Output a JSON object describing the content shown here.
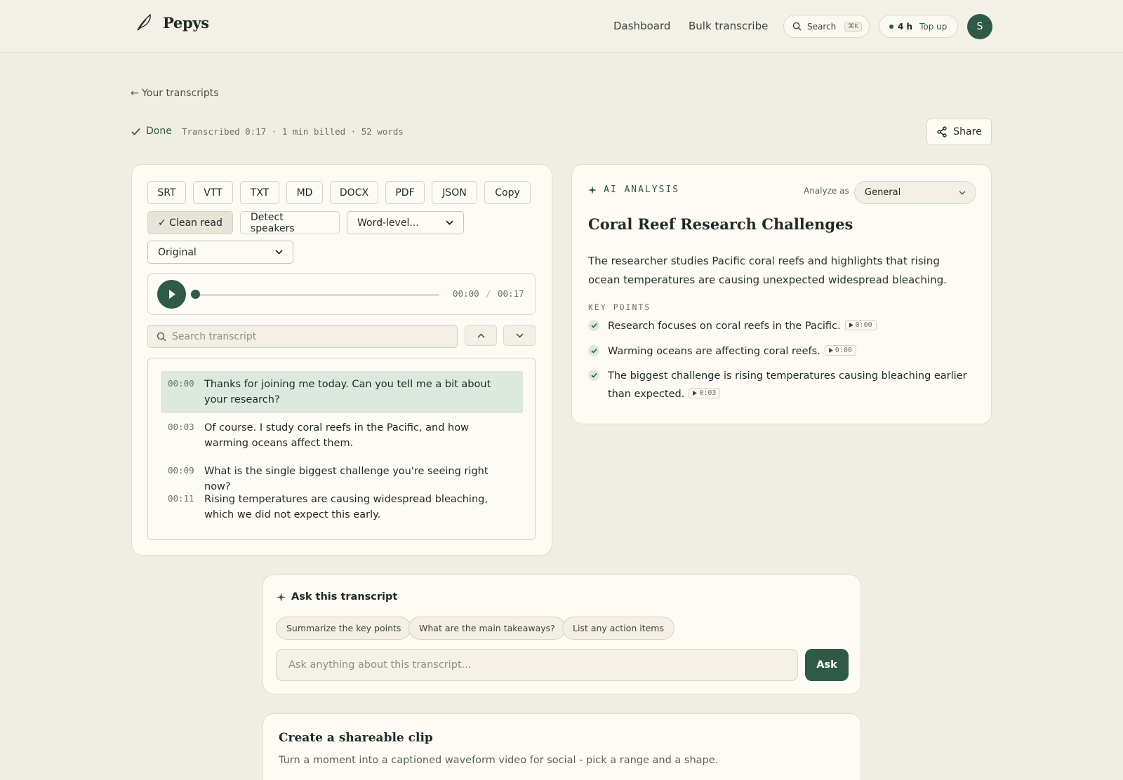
{
  "header": {
    "brand": "Pepys",
    "nav": {
      "dashboard": "Dashboard",
      "bulk": "Bulk transcribe"
    },
    "search": {
      "label": "Search",
      "shortcut": "⌘K"
    },
    "hours": {
      "amount": "4 h",
      "topup": "Top up"
    },
    "avatar_initial": "S"
  },
  "back_link": "← Your transcripts",
  "status": {
    "label": "Done",
    "meta": "Transcribed 0:17 · 1 min billed · 52 words"
  },
  "share_label": "Share",
  "export": {
    "formats": [
      "SRT",
      "VTT",
      "TXT",
      "MD",
      "DOCX",
      "PDF",
      "JSON",
      "Copy"
    ],
    "clean_read": "✓ Clean read",
    "detect_speakers": "Detect speakers",
    "word_level": "Word-level...",
    "language": "Original"
  },
  "player": {
    "current": "00:00",
    "separator": "/",
    "duration": "00:17",
    "progress": 0
  },
  "transcript_search": {
    "placeholder": "Search transcript"
  },
  "segments": [
    {
      "time": "00:00",
      "text": "Thanks for joining me today. Can you tell me a bit about your research?"
    },
    {
      "time": "00:03",
      "text": "Of course. I study coral reefs in the Pacific, and how warming oceans affect them."
    },
    {
      "time": "00:09",
      "text": "What is the single biggest challenge you're seeing right now?"
    },
    {
      "time": "00:11",
      "text": "Rising temperatures are causing widespread bleaching, which we did not expect this early."
    }
  ],
  "analysis": {
    "heading": "AI ANALYSIS",
    "analyze_as_label": "Analyze as",
    "analyze_as_value": "General",
    "title": "Coral Reef Research Challenges",
    "summary": "The researcher studies Pacific coral reefs and highlights that rising ocean temperatures are causing unexpected widespread bleaching.",
    "key_points_heading": "KEY POINTS",
    "key_points": [
      {
        "text": "Research focuses on coral reefs in the Pacific.",
        "time": "0:00"
      },
      {
        "text": "Warming oceans are affecting coral reefs.",
        "time": "0:00"
      },
      {
        "text": "The biggest challenge is rising temperatures causing bleaching earlier than expected.",
        "time": "0:03"
      }
    ]
  },
  "ask": {
    "heading": "Ask this transcript",
    "chips": [
      "Summarize the key points",
      "What are the main takeaways?",
      "List any action items"
    ],
    "placeholder": "Ask anything about this transcript...",
    "button": "Ask"
  },
  "clip": {
    "heading": "Create a shareable clip",
    "subtitle": "Turn a moment into a captioned waveform video for social - pick a range and a shape."
  },
  "colors": {
    "accent": "#2f5a48",
    "background": "#f0ede3",
    "card": "#fdfbf4",
    "highlight": "#dde8df"
  }
}
